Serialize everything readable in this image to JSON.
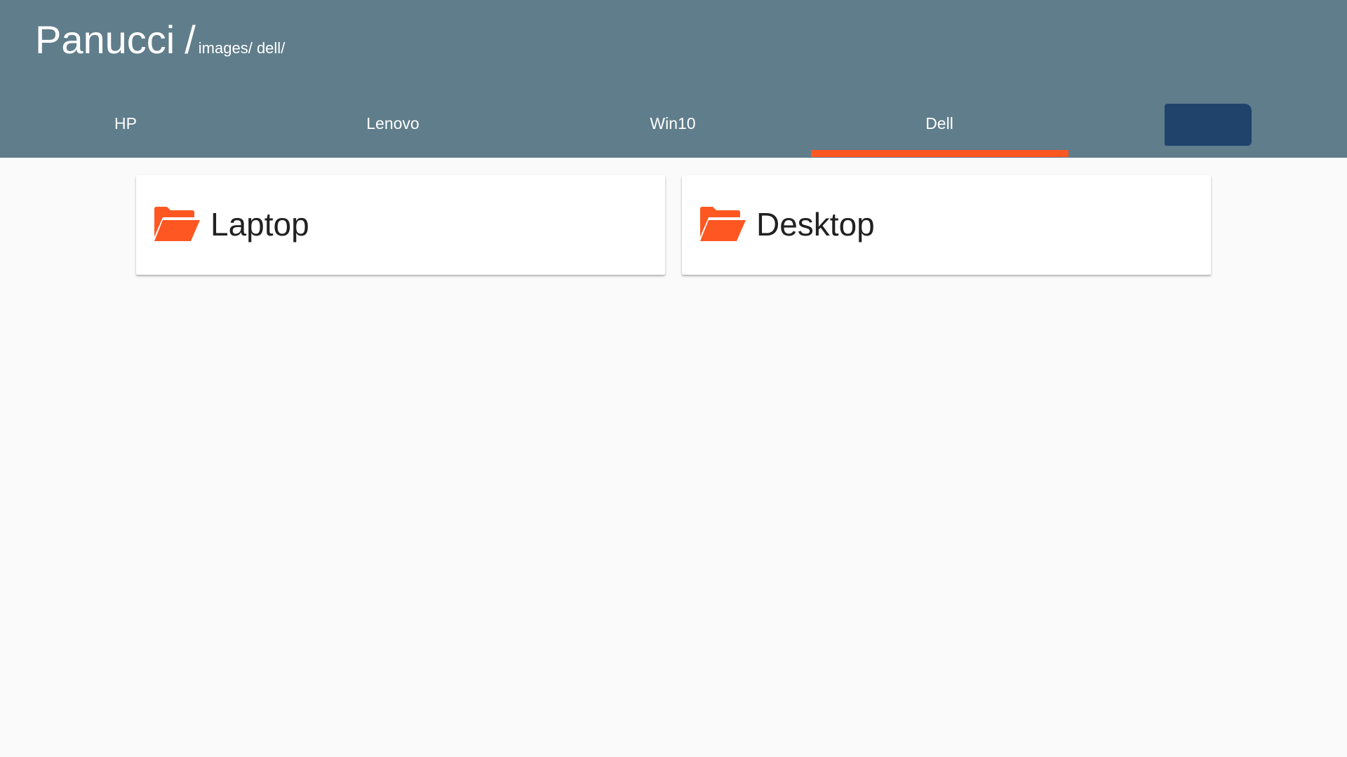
{
  "header": {
    "title": "Panucci",
    "separator": "/",
    "breadcrumb": "images/ dell/"
  },
  "tabs": [
    {
      "label": "HP",
      "selected": false
    },
    {
      "label": "Lenovo",
      "selected": false
    },
    {
      "label": "Win10",
      "selected": false
    },
    {
      "label": "Dell",
      "selected": true
    }
  ],
  "folders": [
    {
      "label": "Laptop",
      "icon": "folder-open-icon"
    },
    {
      "label": "Desktop",
      "icon": "folder-open-icon"
    }
  ],
  "colors": {
    "header_bg": "#607d8b",
    "accent": "#ff5722",
    "page_bg": "#fafafa",
    "redaction": "#1f436b"
  }
}
